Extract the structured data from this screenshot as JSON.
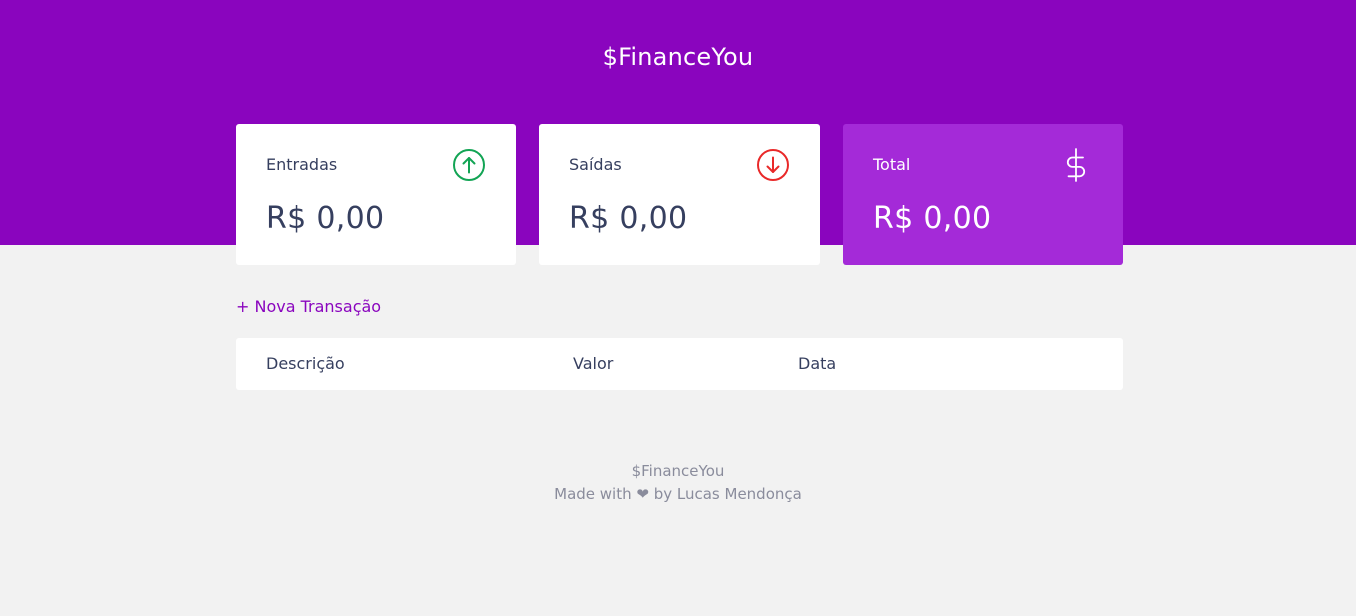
{
  "header": {
    "logo": "$FinanceYou"
  },
  "cards": [
    {
      "label": "Entradas",
      "value": "R$ 0,00",
      "icon": "arrow-up-circle-icon",
      "icon_color": "#12a454"
    },
    {
      "label": "Saídas",
      "value": "R$ 0,00",
      "icon": "arrow-down-circle-icon",
      "icon_color": "#e92929"
    },
    {
      "label": "Total",
      "value": "R$ 0,00",
      "icon": "dollar-sign-icon",
      "icon_color": "#ffffff"
    }
  ],
  "actions": {
    "new_transaction": "+ Nova Transação"
  },
  "table": {
    "columns": [
      "Descrição",
      "Valor",
      "Data"
    ],
    "rows": []
  },
  "footer": {
    "brand": "$FinanceYou",
    "credit": "Made with ❤ by Lucas Mendonça"
  },
  "colors": {
    "brand": "#8a05be",
    "total_card": "#a42ad8",
    "background": "#f2f2f2"
  }
}
